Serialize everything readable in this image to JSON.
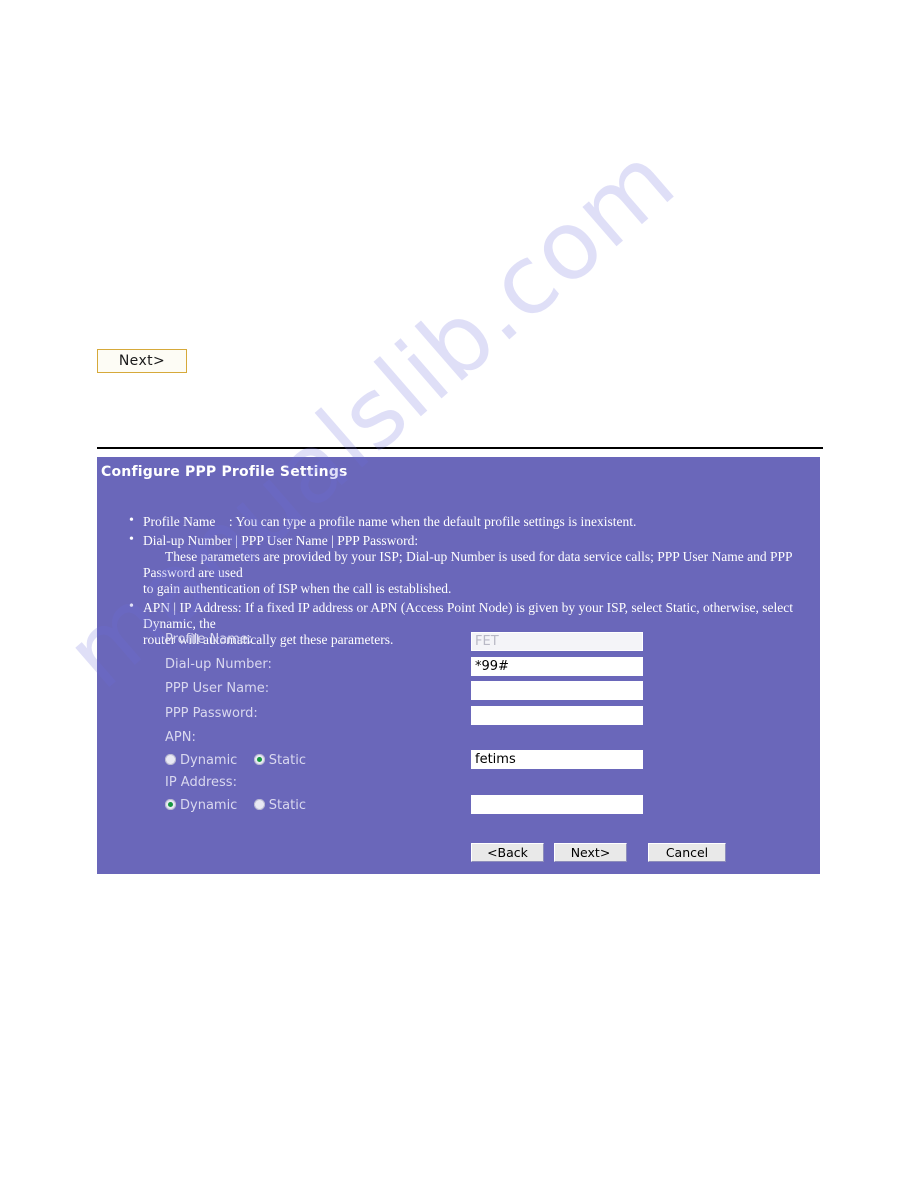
{
  "page": {
    "background_color": "#ffffff",
    "watermark_text": "manualslib.com"
  },
  "top_action": {
    "next_label": "Next>"
  },
  "panel": {
    "title": "Configure PPP Profile Settings",
    "background_color": "#6a67ba",
    "help_items": [
      {
        "line1": "Profile Name : You can type a profile name when the default profile settings is inexistent."
      },
      {
        "line1": "Dial-up Number | PPP User Name | PPP Password:",
        "line2": "These parameters are provided by your ISP; Dial-up Number is used for data service calls; PPP User Name and PPP Password are used",
        "line3": "to gain authentication of ISP when the call is established."
      },
      {
        "line1": "APN | IP Address: If a fixed IP address or APN (Access Point Node) is given by your ISP, select Static, otherwise, select Dynamic, the",
        "line2": "router will automatically get these parameters."
      }
    ],
    "fields": [
      {
        "label": "Profile Name:",
        "value": "FET",
        "placeholder": "",
        "disabled": true
      },
      {
        "label": "Dial-up Number:",
        "value": "*99#",
        "placeholder": "",
        "disabled": false
      },
      {
        "label": "PPP User Name:",
        "value": "",
        "placeholder": "",
        "disabled": false
      },
      {
        "label": "PPP Password:",
        "value": "",
        "placeholder": "",
        "disabled": false
      }
    ],
    "apn": {
      "label": "APN:",
      "options": [
        {
          "label": "Dynamic",
          "selected": false
        },
        {
          "label": "Static",
          "selected": true
        }
      ],
      "value": "fetims",
      "placeholder": ""
    },
    "ip_address": {
      "label": "IP Address:",
      "options": [
        {
          "label": "Dynamic",
          "selected": true
        },
        {
          "label": "Static",
          "selected": false
        }
      ],
      "value": "",
      "placeholder": ""
    },
    "buttons": {
      "back": "<Back",
      "next": "Next>",
      "cancel": "Cancel"
    },
    "radio_selected_color": "#15963f"
  }
}
